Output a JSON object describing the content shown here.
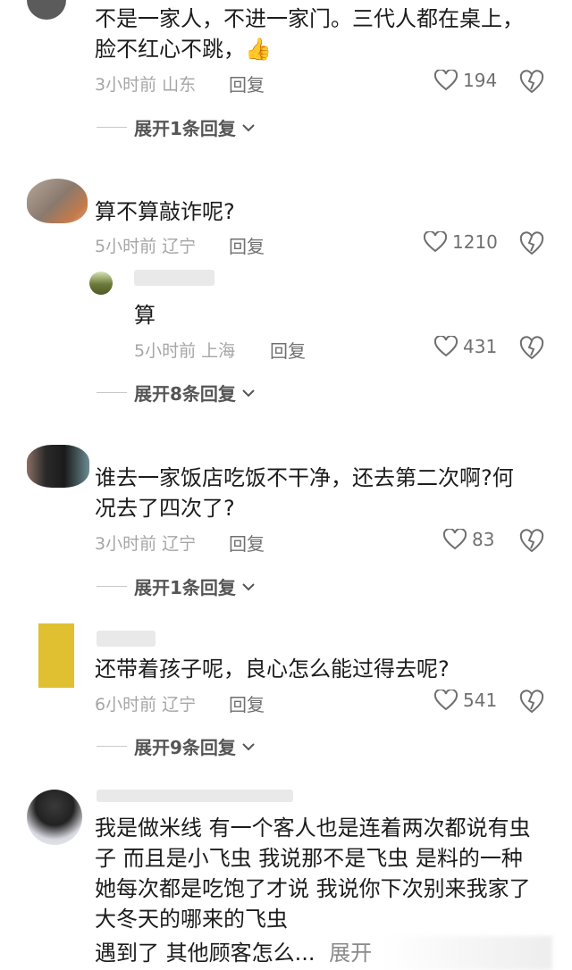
{
  "comments": [
    {
      "text": "不是一家人，不进一家门。三代人都在桌上，脸不红心不跳，",
      "emoji": "👍",
      "time_loc": "3小时前 山东",
      "reply": "回复",
      "likes": "194",
      "expand": "展开1条回复"
    },
    {
      "text": "算不算敲诈呢?",
      "time_loc": "5小时前 辽宁",
      "reply": "回复",
      "likes": "1210",
      "sub": {
        "text": "算",
        "time_loc": "5小时前 上海",
        "reply": "回复",
        "likes": "431"
      },
      "expand": "展开8条回复"
    },
    {
      "text": "谁去一家饭店吃饭不干净，还去第二次啊?何况去了四次了?",
      "time_loc": "3小时前 辽宁",
      "reply": "回复",
      "likes": "83",
      "expand": "展开1条回复"
    },
    {
      "text": "还带着孩子呢，良心怎么能过得去呢?",
      "time_loc": "6小时前 辽宁",
      "reply": "回复",
      "likes": "541",
      "expand": "展开9条回复"
    },
    {
      "text": "我是做米线 有一个客人也是连着两次都说有虫子 而且是小飞虫 我说那不是飞虫 是料的一种 她每次都是吃饱了才说 我说你下次别来我家了 大冬天的哪来的飞虫",
      "text_tail": "遇到了 其他顾客怎么...",
      "more": "展开"
    }
  ],
  "colors": {
    "meta": "#a6a6a6",
    "icon": "#6f6f6f",
    "text": "#1c1c1c"
  },
  "icons": {
    "like": "heart-icon",
    "dislike": "broken-heart-icon",
    "expand": "chevron-down-icon"
  }
}
